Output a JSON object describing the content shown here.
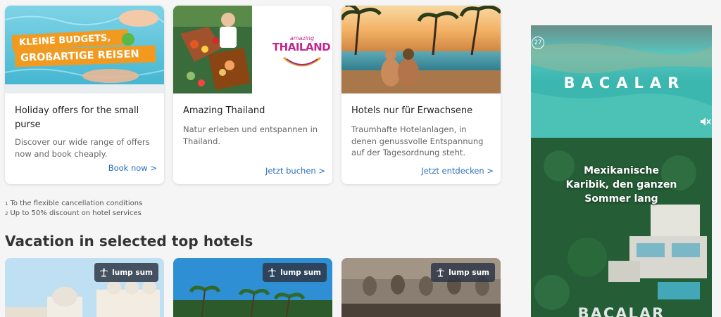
{
  "cards": [
    {
      "banner_line1": "KLEINE BUDGETS,",
      "banner_line2": "GROßARTIGE REISEN",
      "title": "Holiday offers for the small purse",
      "description": "Discover our wide range of offers now and book cheaply.",
      "link": "Book now >"
    },
    {
      "logo_small": "amazing",
      "logo_big": "THAILAND",
      "title": "Amazing Thailand",
      "description": "Natur erleben und entspannen in Thailand.",
      "link": "Jetzt buchen >"
    },
    {
      "title": "Hotels nur für Erwachsene",
      "description": "Traumhafte Hotelanlagen, in denen genussvolle Entspannung auf der Tagesordnung steht.",
      "link": "Jetzt entdecken >"
    }
  ],
  "footnotes": [
    {
      "mark": "1",
      "text": "To the flexible cancellation conditions"
    },
    {
      "mark": "2",
      "text": "Up to 50% discount on hotel services"
    }
  ],
  "section_title": "Vacation in selected top hotels",
  "hotels": [
    {
      "badge": "lump sum"
    },
    {
      "badge": "lump sum"
    },
    {
      "badge": "lump sum"
    }
  ],
  "ad": {
    "counter": "27",
    "title": "BACALAR",
    "subtitle_line1": "Mexikanische",
    "subtitle_line2": "Karibik, den ganzen",
    "subtitle_line3": "Sommer lang",
    "bottom": "BACALAR"
  },
  "colors": {
    "link": "#2a6ebb",
    "banner_orange": "#f29a1f",
    "badge_bg": "#2d3746"
  }
}
